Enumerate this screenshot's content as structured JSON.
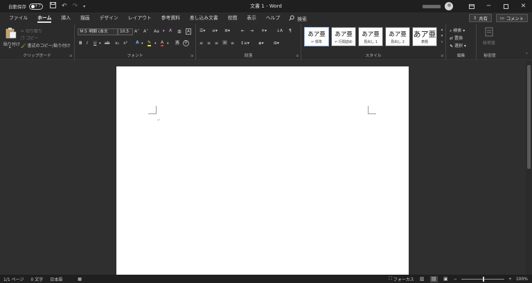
{
  "titlebar": {
    "autosave_label": "自動保存",
    "autosave_state": "オフ",
    "doc_title": "文書 1  -  Word",
    "icons": [
      "save-icon",
      "undo-icon",
      "redo-icon",
      "customize-qat-icon"
    ]
  },
  "tabs": {
    "items": [
      "ファイル",
      "ホーム",
      "挿入",
      "描画",
      "デザイン",
      "レイアウト",
      "参考資料",
      "差し込み文書",
      "校閲",
      "表示",
      "ヘルプ"
    ],
    "active": "ホーム",
    "search_label": "検索",
    "share_label": "共有",
    "comment_label": "コメント"
  },
  "ribbon": {
    "clipboard": {
      "label": "クリップボード",
      "paste": "貼り付け",
      "cut": "切り取り",
      "copy": "コピー",
      "format_painter": "書式のコピー/貼り付け"
    },
    "font": {
      "label": "フォント",
      "font_name": "ＭＳ 明朝 (本文",
      "font_size": "10.5",
      "grow": "A˄",
      "shrink": "A˅",
      "case": "Aa",
      "bold": "B",
      "italic": "I",
      "underline": "U",
      "strike": "ab",
      "subscript": "x₂",
      "superscript": "x²"
    },
    "paragraph": {
      "label": "段落"
    },
    "styles": {
      "label": "スタイル",
      "items": [
        {
          "sample": "あア亜",
          "name": "↵ 標準"
        },
        {
          "sample": "あア亜",
          "name": "↵ 行間詰め"
        },
        {
          "sample": "あア亜",
          "name": "見出し 1"
        },
        {
          "sample": "あア亜",
          "name": "見出し 2"
        },
        {
          "sample": "あア亜",
          "name": "表題"
        }
      ]
    },
    "editing": {
      "label": "編集",
      "find": "検索",
      "replace": "置換",
      "select": "選択"
    },
    "sensitivity": {
      "label": "秘密度",
      "button": "秘密度"
    }
  },
  "statusbar": {
    "page": "1/1 ページ",
    "words": "0 文字",
    "language": "日本語",
    "focus": "フォーカス",
    "zoom": "100%",
    "zoom_level": 0.5
  }
}
